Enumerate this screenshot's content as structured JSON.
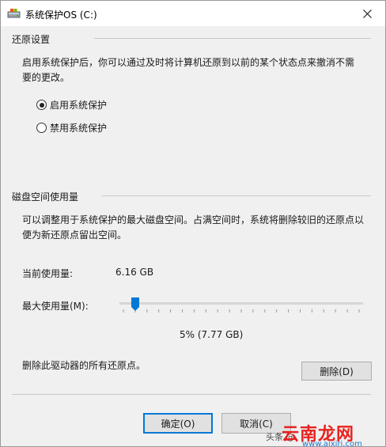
{
  "window": {
    "title": "系统保护OS (C:)"
  },
  "restore_settings": {
    "title": "还原设置",
    "description": "启用系统保护后，你可以通过及时将计算机还原到以前的某个状态点来撤消不需要的更改。",
    "options": [
      {
        "label": "启用系统保护",
        "selected": true
      },
      {
        "label": "禁用系统保护",
        "selected": false
      }
    ]
  },
  "disk_usage": {
    "title": "磁盘空间使用量",
    "description": "可以调整用于系统保护的最大磁盘空间。占满空间时，系统将删除较旧的还原点以便为新还原点留出空间。",
    "current_label": "当前使用量:",
    "current_value": "6.16 GB",
    "max_label": "最大使用量(M):",
    "max_percent": 5,
    "max_value_text": "5% (7.77 GB)",
    "delete_text": "删除此驱动器的所有还原点。",
    "delete_button": "删除(D)"
  },
  "buttons": {
    "ok": "确定(O)",
    "cancel": "取消(C)"
  },
  "watermark": {
    "head": "头条 @",
    "brand": "云南龙网",
    "url": "www.aixiri.com"
  },
  "colors": {
    "accent": "#0078d7",
    "watermark_red": "#e8231f"
  }
}
